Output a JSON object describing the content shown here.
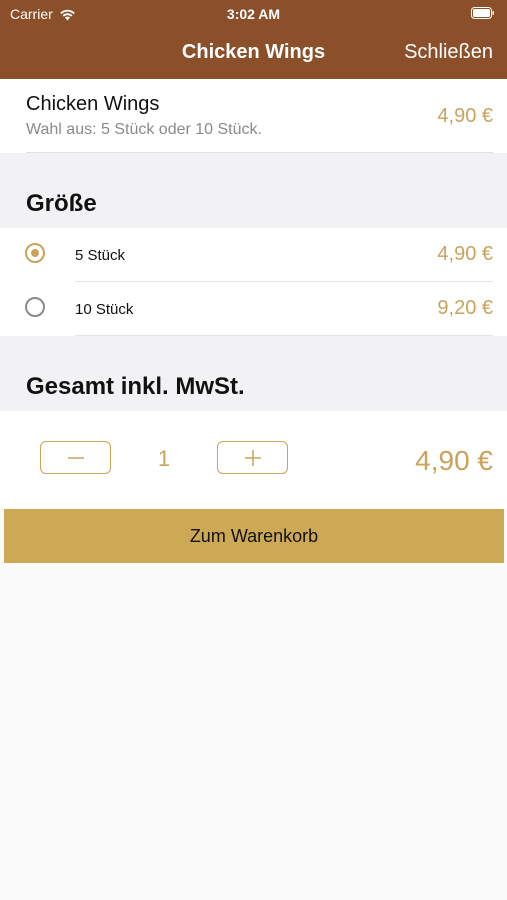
{
  "status_bar": {
    "carrier": "Carrier",
    "time": "3:02 AM",
    "icons": [
      "wifi-icon",
      "battery-icon"
    ]
  },
  "nav": {
    "title": "Chicken Wings",
    "close_label": "Schließen"
  },
  "product": {
    "name": "Chicken Wings",
    "description": "Wahl aus: 5 Stück oder 10 Stück.",
    "price": "4,90 €"
  },
  "size_section": {
    "title": "Größe",
    "options": [
      {
        "label": "5 Stück",
        "price": "4,90 €",
        "selected": true
      },
      {
        "label": "10 Stück",
        "price": "9,20 €",
        "selected": false
      }
    ]
  },
  "total_section": {
    "title": "Gesamt inkl. MwSt.",
    "quantity": "1",
    "total": "4,90 €"
  },
  "cart": {
    "label": "Zum Warenkorb"
  },
  "colors": {
    "nav_background": "#8b4f2a",
    "accent": "#c9a35a",
    "cart_button": "#cda956",
    "section_background": "#f2f2f4"
  }
}
